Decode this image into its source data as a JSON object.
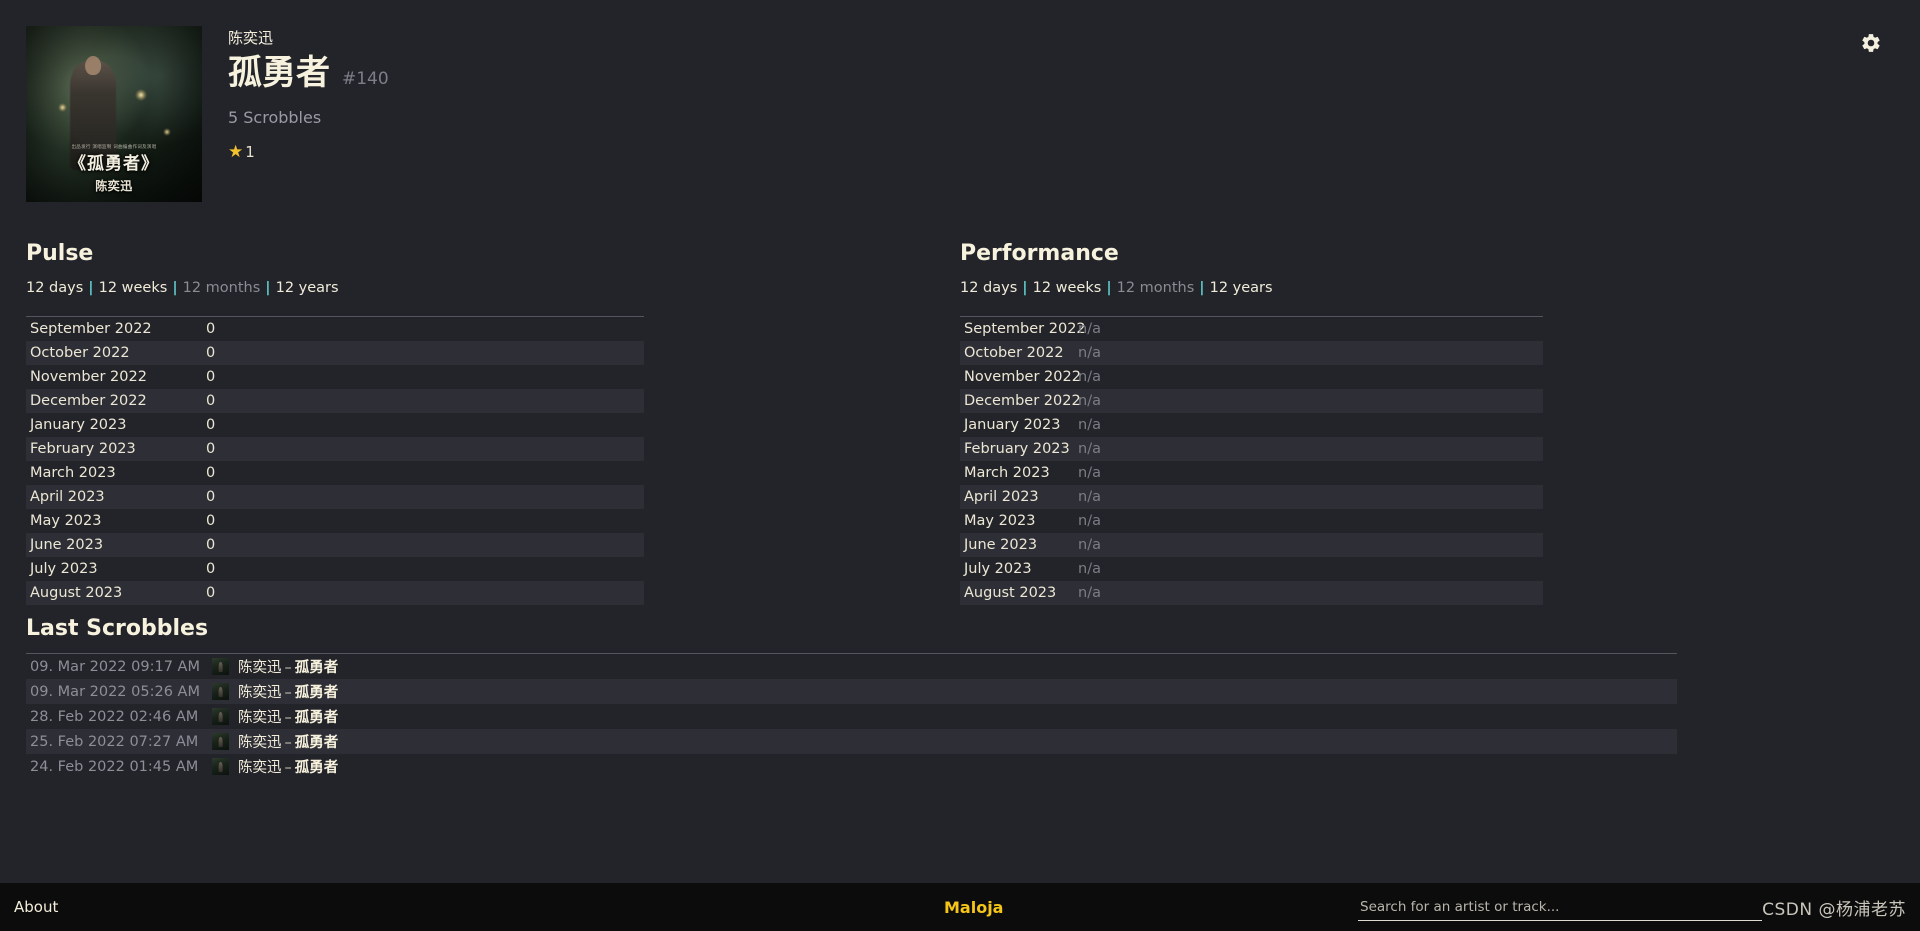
{
  "header": {
    "artist": "陈奕迅",
    "track_title": "孤勇者",
    "rank": "#140",
    "scrobbles": "5 Scrobbles",
    "star_icon": "star-icon",
    "star_count": "1",
    "settings_icon": "gear-icon",
    "cover": {
      "title_text": "《孤勇者》",
      "artist_text": "陈奕迅",
      "credits_text": "出品发行 演唱监制 词曲编曲作词及演唱"
    }
  },
  "pulse": {
    "title": "Pulse",
    "ranges": [
      {
        "label": "12 days",
        "active": false
      },
      {
        "label": "12 weeks",
        "active": false
      },
      {
        "label": "12 months",
        "active": true
      },
      {
        "label": "12 years",
        "active": false
      }
    ],
    "separator": "|",
    "rows": [
      {
        "label": "September 2022",
        "value": "0"
      },
      {
        "label": "October 2022",
        "value": "0"
      },
      {
        "label": "November 2022",
        "value": "0"
      },
      {
        "label": "December 2022",
        "value": "0"
      },
      {
        "label": "January 2023",
        "value": "0"
      },
      {
        "label": "February 2023",
        "value": "0"
      },
      {
        "label": "March 2023",
        "value": "0"
      },
      {
        "label": "April 2023",
        "value": "0"
      },
      {
        "label": "May 2023",
        "value": "0"
      },
      {
        "label": "June 2023",
        "value": "0"
      },
      {
        "label": "July 2023",
        "value": "0"
      },
      {
        "label": "August 2023",
        "value": "0"
      }
    ]
  },
  "performance": {
    "title": "Performance",
    "ranges": [
      {
        "label": "12 days",
        "active": false
      },
      {
        "label": "12 weeks",
        "active": false
      },
      {
        "label": "12 months",
        "active": true
      },
      {
        "label": "12 years",
        "active": false
      }
    ],
    "separator": "|",
    "rows": [
      {
        "label": "September 2022",
        "value": "n/a"
      },
      {
        "label": "October 2022",
        "value": "n/a"
      },
      {
        "label": "November 2022",
        "value": "n/a"
      },
      {
        "label": "December 2022",
        "value": "n/a"
      },
      {
        "label": "January 2023",
        "value": "n/a"
      },
      {
        "label": "February 2023",
        "value": "n/a"
      },
      {
        "label": "March 2023",
        "value": "n/a"
      },
      {
        "label": "April 2023",
        "value": "n/a"
      },
      {
        "label": "May 2023",
        "value": "n/a"
      },
      {
        "label": "June 2023",
        "value": "n/a"
      },
      {
        "label": "July 2023",
        "value": "n/a"
      },
      {
        "label": "August 2023",
        "value": "n/a"
      }
    ]
  },
  "last_scrobbles": {
    "title": "Last Scrobbles",
    "dash": "–",
    "rows": [
      {
        "time": "09. Mar 2022 09:17 AM",
        "artist": "陈奕迅",
        "track": "孤勇者"
      },
      {
        "time": "09. Mar 2022 05:26 AM",
        "artist": "陈奕迅",
        "track": "孤勇者"
      },
      {
        "time": "28. Feb 2022 02:46 AM",
        "artist": "陈奕迅",
        "track": "孤勇者"
      },
      {
        "time": "25. Feb 2022 07:27 AM",
        "artist": "陈奕迅",
        "track": "孤勇者"
      },
      {
        "time": "24. Feb 2022 01:45 AM",
        "artist": "陈奕迅",
        "track": "孤勇者"
      }
    ]
  },
  "footer": {
    "about": "About",
    "brand": "Maloja",
    "search_placeholder": "Search for an artist or track...",
    "search_value": "",
    "watermark": "CSDN @杨浦老苏"
  },
  "colors": {
    "page_bg": "#23232a",
    "row_alt_bg": "#2e2e36",
    "text_primary": "#f7f2dd",
    "text_muted": "#8e8e98",
    "accent_separator": "#5ec7c7",
    "brand": "#f5c518",
    "star": "#f2c12e",
    "footer_bg": "#0c0c0c"
  }
}
